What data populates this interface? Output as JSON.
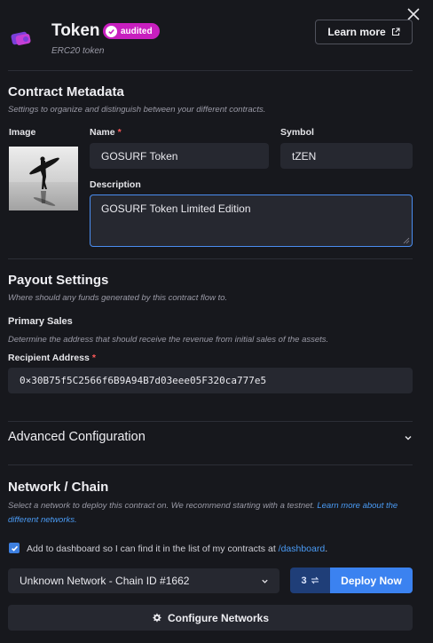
{
  "header": {
    "title": "Token",
    "badge": "audited",
    "subtitle": "ERC20 token",
    "learn_more": "Learn more"
  },
  "metadata": {
    "title": "Contract Metadata",
    "subtitle": "Settings to organize and distinguish between your different contracts.",
    "image_label": "Image",
    "name_label": "Name",
    "name_value": "GOSURF Token",
    "symbol_label": "Symbol",
    "symbol_value": "tZEN",
    "description_label": "Description",
    "description_value": "GOSURF Token Limited Edition",
    "required_mark": "*"
  },
  "payout": {
    "title": "Payout Settings",
    "subtitle": "Where should any funds generated by this contract flow to.",
    "primary_sales_label": "Primary Sales",
    "primary_sales_sub": "Determine the address that should receive the revenue from initial sales of the assets.",
    "recipient_label": "Recipient Address",
    "recipient_value": "0×30B75f5C2566f6B9A94B7d03eee05F320ca777e5"
  },
  "advanced": {
    "title": "Advanced Configuration"
  },
  "network": {
    "title": "Network / Chain",
    "subtitle_pre": "Select a network to deploy this contract on. We recommend starting with a testnet.",
    "subtitle_link": "Learn more about the different networks.",
    "checkbox_label": "Add to dashboard so I can find it in the list of my contracts at",
    "checkbox_link": "/dashboard",
    "checkbox_period": ".",
    "select_value": "Unknown Network - Chain ID #1662",
    "chain_count": "3",
    "deploy_label": "Deploy Now",
    "configure_label": "Configure Networks"
  },
  "colors": {
    "accent": "#3b82f0",
    "badge": "#c81fbf",
    "background": "#17181d",
    "input_bg": "#262830"
  },
  "icons": [
    "close-icon",
    "token-logo-icon",
    "check-icon",
    "external-link-icon",
    "chevron-down-icon",
    "switch-icon",
    "gear-icon"
  ]
}
